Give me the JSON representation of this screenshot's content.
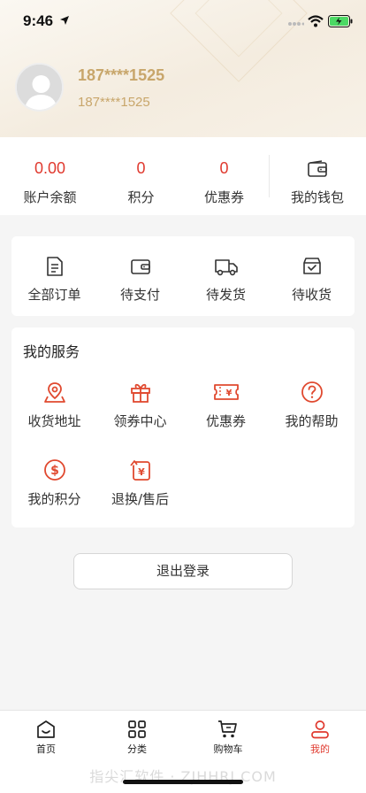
{
  "status_bar": {
    "time": "9:46"
  },
  "profile": {
    "name": "187****1525",
    "phone": "187****1525"
  },
  "assets": [
    {
      "value": "0.00",
      "label": "账户余额"
    },
    {
      "value": "0",
      "label": "积分"
    },
    {
      "value": "0",
      "label": "优惠券"
    }
  ],
  "wallet": {
    "label": "我的钱包",
    "icon": "wallet-icon"
  },
  "orders": [
    {
      "label": "全部订单",
      "icon": "document-icon"
    },
    {
      "label": "待支付",
      "icon": "wallet-icon"
    },
    {
      "label": "待发货",
      "icon": "truck-icon"
    },
    {
      "label": "待收货",
      "icon": "box-check-icon"
    }
  ],
  "services": {
    "title": "我的服务",
    "items": [
      {
        "label": "收货地址",
        "icon": "map-pin-icon"
      },
      {
        "label": "领券中心",
        "icon": "gift-icon"
      },
      {
        "label": "优惠券",
        "icon": "coupon-icon"
      },
      {
        "label": "我的帮助",
        "icon": "help-icon"
      },
      {
        "label": "我的积分",
        "icon": "dollar-coin-icon"
      },
      {
        "label": "退换/售后",
        "icon": "refund-icon"
      }
    ]
  },
  "logout_label": "退出登录",
  "tabbar": [
    {
      "label": "首页",
      "icon": "home-icon",
      "active": false
    },
    {
      "label": "分类",
      "icon": "grid-icon",
      "active": false
    },
    {
      "label": "购物车",
      "icon": "cart-icon",
      "active": false
    },
    {
      "label": "我的",
      "icon": "user-icon",
      "active": true
    }
  ],
  "watermark": "指尖汇软件 · ZJHHRJ.COM",
  "colors": {
    "accent": "#e03a2f",
    "gold": "#c8a66b",
    "background": "#f5f5f5"
  }
}
